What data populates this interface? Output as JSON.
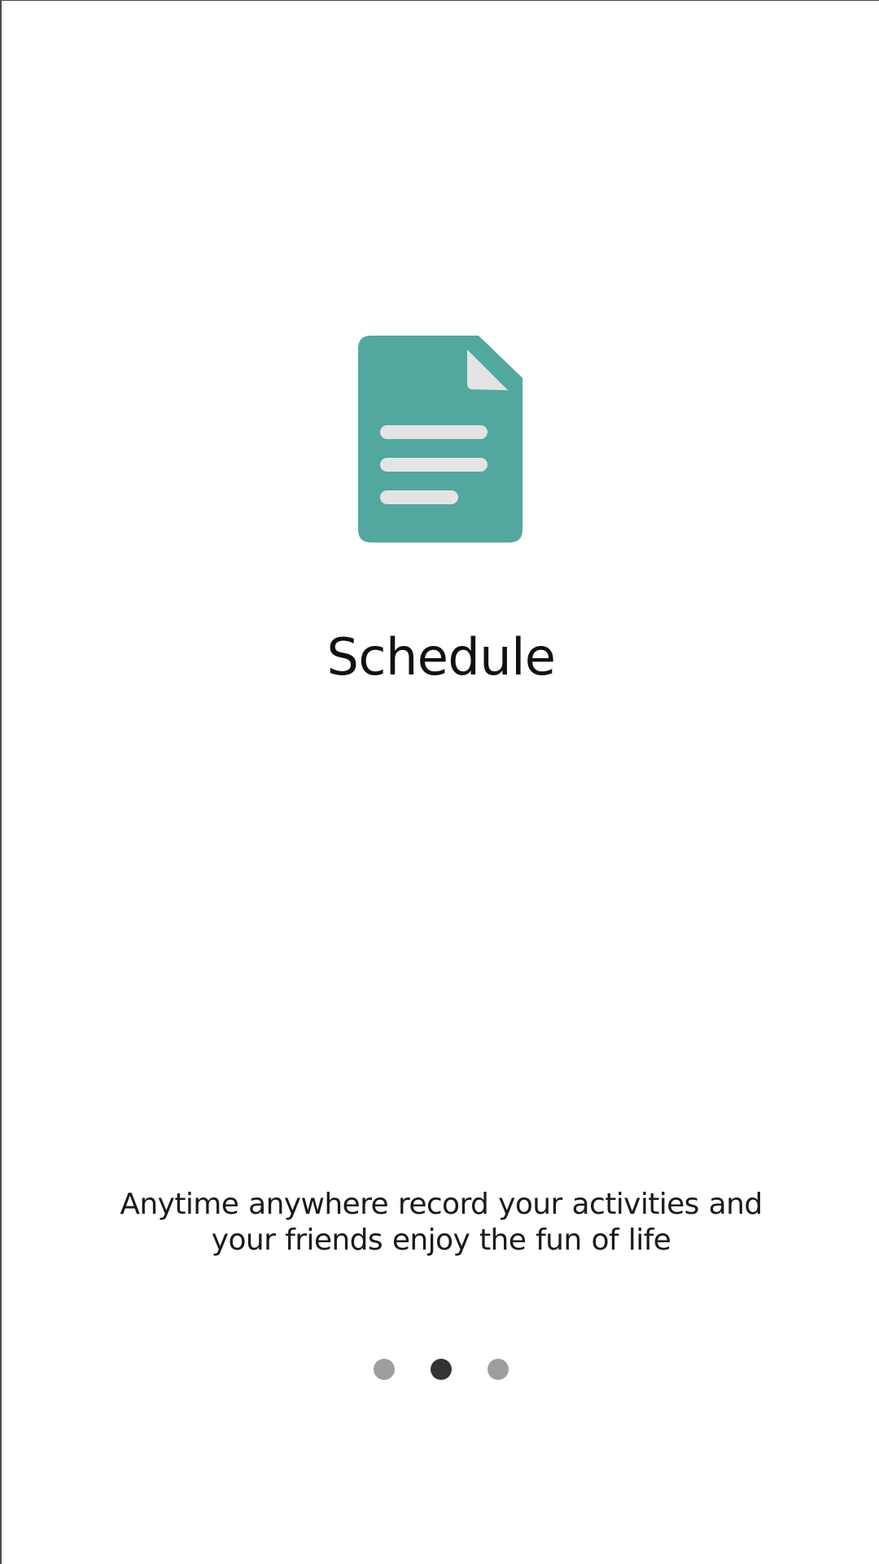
{
  "onboarding": {
    "icon": "document-icon",
    "title": "Schedule",
    "description": "Anytime anywhere record your activities  and your friends enjoy the fun of life",
    "pager": {
      "count": 3,
      "active_index": 1
    }
  },
  "colors": {
    "icon_body": "#52A89E",
    "icon_lines": "#E4E4E4",
    "dot_inactive": "#9E9E9E",
    "dot_active": "#333333",
    "text": "#111111"
  }
}
